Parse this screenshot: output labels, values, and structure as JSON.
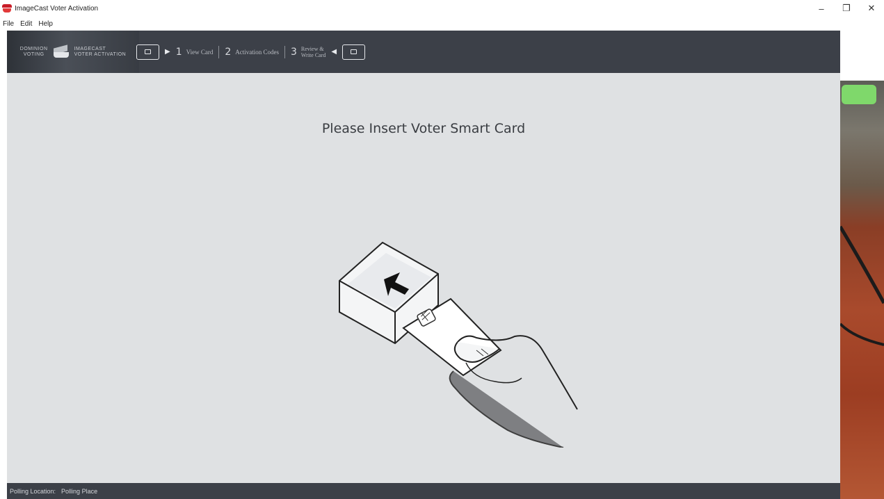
{
  "window": {
    "title": "ImageCast Voter Activation",
    "controls": {
      "minimize": "–",
      "maximize": "❐",
      "close": "✕"
    }
  },
  "menu": [
    "File",
    "Edit",
    "Help"
  ],
  "header": {
    "logo": {
      "left_line1": "DOMINION",
      "left_line2": "VOTING",
      "right_line1": "IMAGECAST",
      "right_line2": "VOTER ACTIVATION"
    },
    "steps": [
      {
        "num": "1",
        "label": "View Card"
      },
      {
        "num": "2",
        "label": "Activation Codes"
      },
      {
        "num": "3",
        "label_line1": "Review &",
        "label_line2": "Write Card"
      }
    ]
  },
  "main": {
    "prompt": "Please Insert Voter Smart Card"
  },
  "status": {
    "label": "Polling Location:",
    "value": "Polling Place"
  },
  "colors": {
    "header_bg": "#3c4048",
    "content_bg": "#dfe1e3",
    "titlebar_icon": "#c81e28"
  },
  "icons": [
    "app-icon",
    "card-icon",
    "arrow-right-icon",
    "arrow-left-icon",
    "smart-card-reader-icon"
  ]
}
